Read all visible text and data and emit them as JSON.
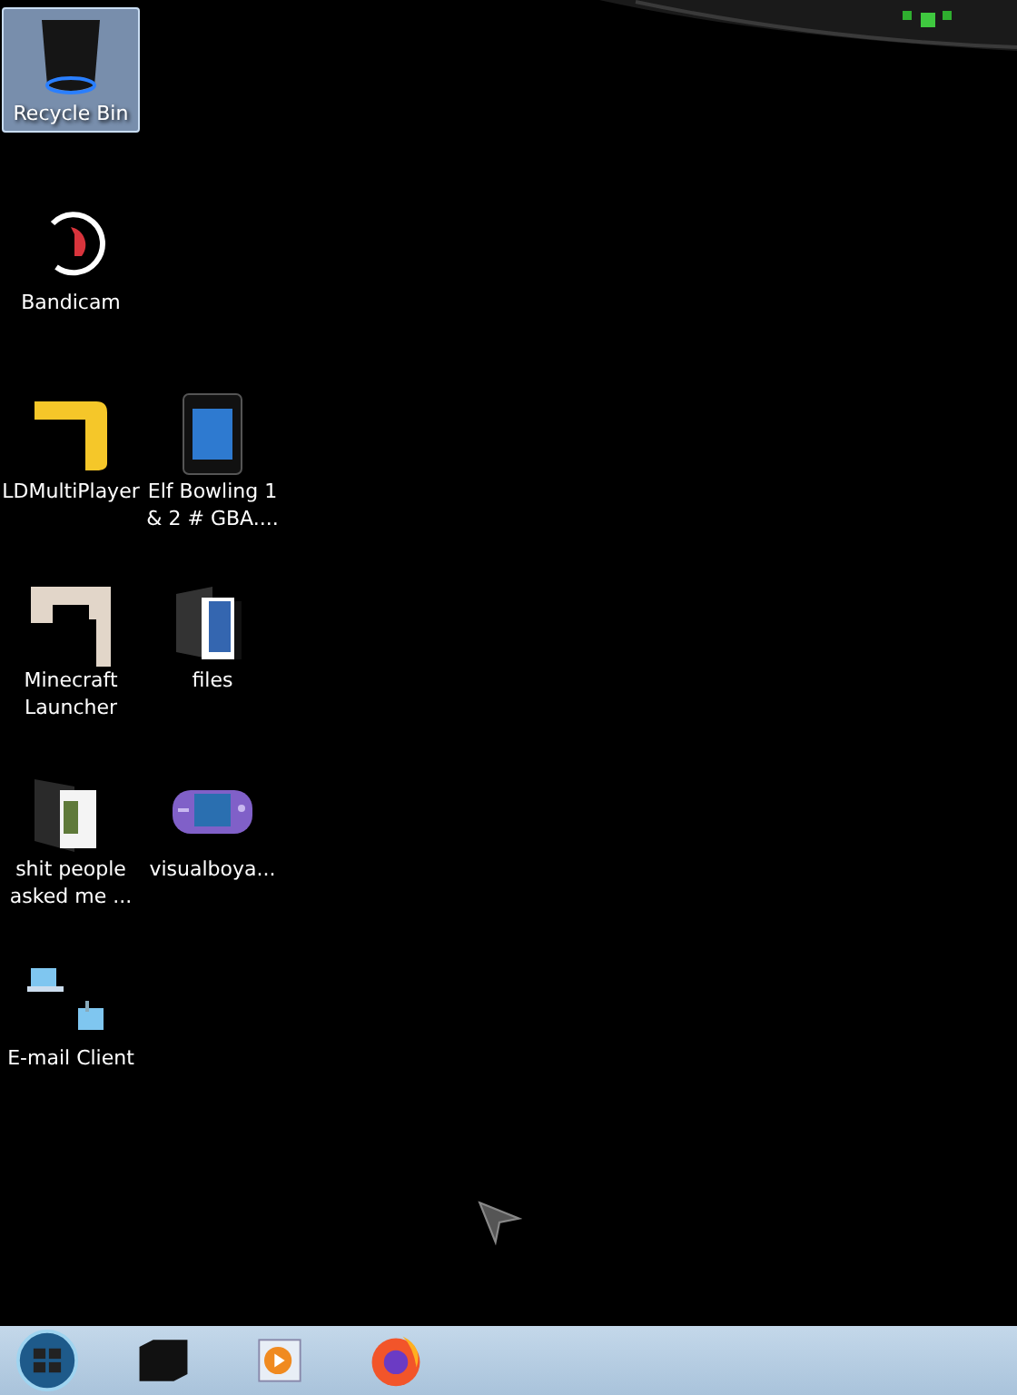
{
  "desktop": {
    "rows": [
      [
        {
          "label": "Recycle Bin",
          "kind": "bin",
          "selected": true
        }
      ],
      [
        {
          "label": "Bandicam",
          "kind": "bandicam",
          "selected": false
        }
      ],
      [
        {
          "label": "LDMultiPlayer",
          "kind": "ld",
          "selected": false
        },
        {
          "label": "Elf Bowling 1 & 2 # GBA....",
          "kind": "tablet",
          "selected": false
        }
      ],
      [
        {
          "label": "Minecraft Launcher",
          "kind": "minecraft",
          "selected": false
        },
        {
          "label": "files",
          "kind": "folder",
          "selected": false
        }
      ],
      [
        {
          "label": "shit people asked me ...",
          "kind": "photofolder",
          "selected": false
        },
        {
          "label": "visualboya...",
          "kind": "gameboy",
          "selected": false
        }
      ],
      [
        {
          "label": "E-mail Client",
          "kind": "email",
          "selected": false
        }
      ]
    ]
  },
  "taskbar": {
    "items": [
      {
        "kind": "start"
      },
      {
        "kind": "box"
      },
      {
        "kind": "player"
      },
      {
        "kind": "browser"
      }
    ]
  }
}
